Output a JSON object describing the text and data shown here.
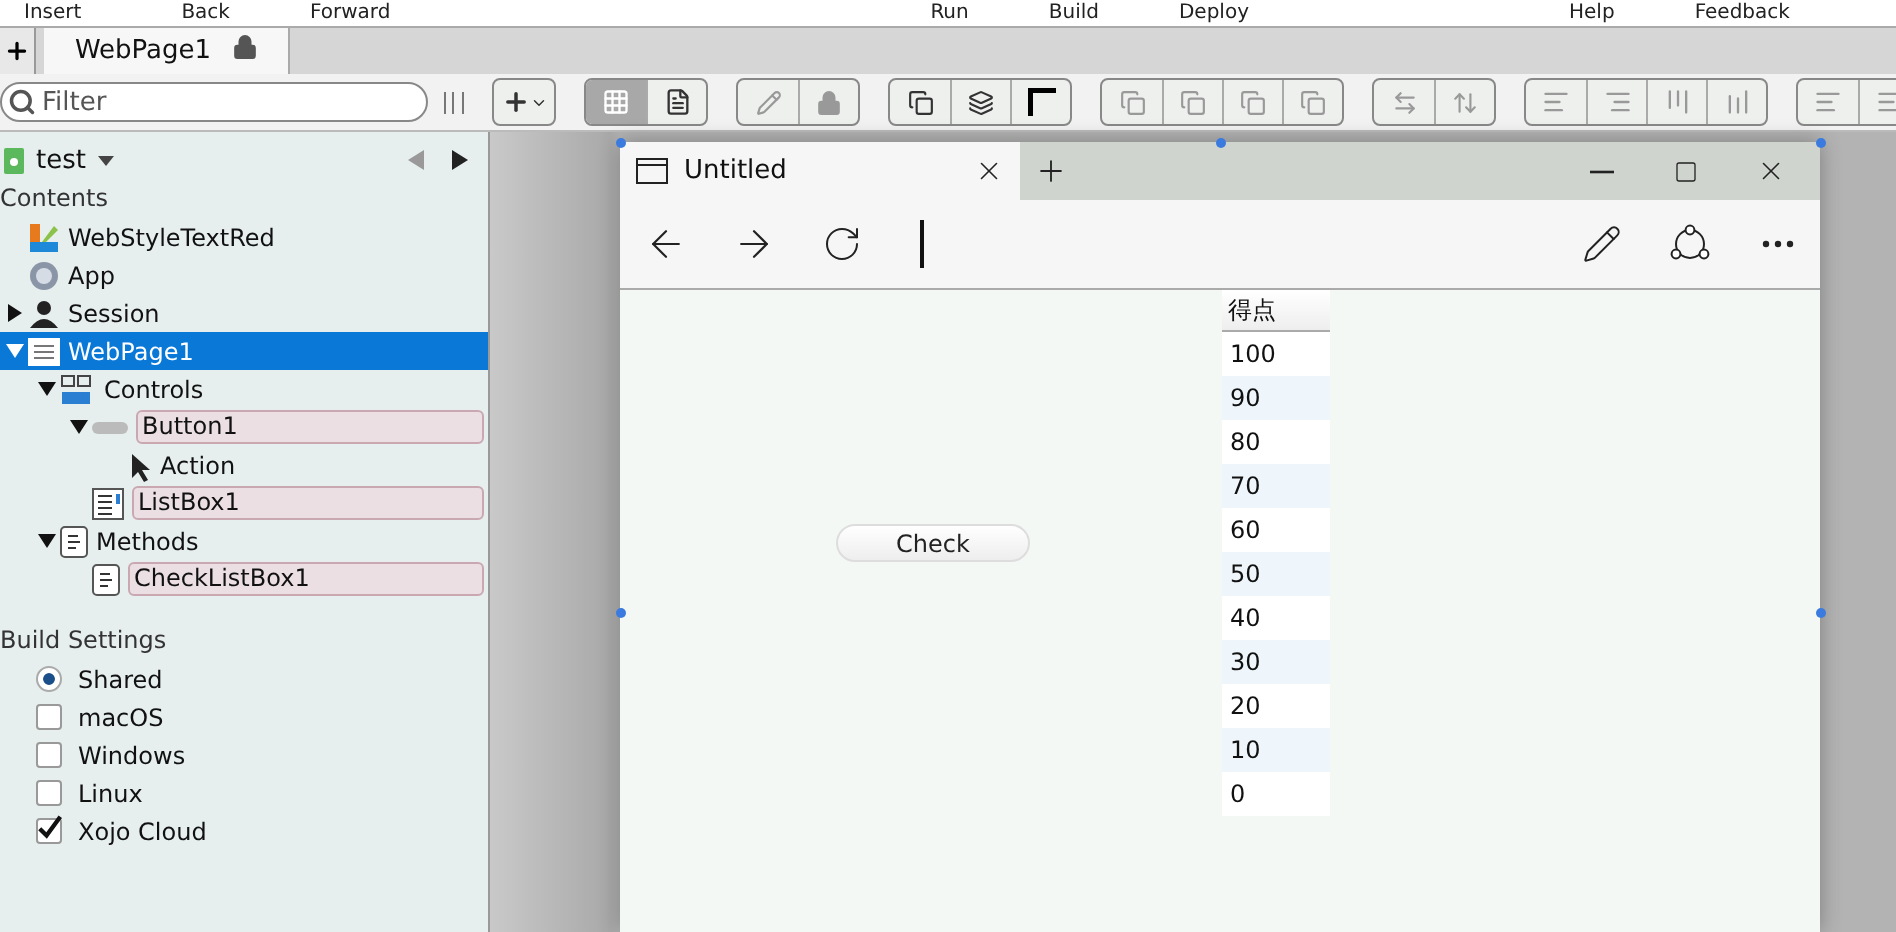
{
  "menu": [
    "Insert",
    "Back",
    "Forward",
    "Run",
    "Build",
    "Deploy",
    "Help",
    "Feedback"
  ],
  "tabs": [
    {
      "label": "WebPage1",
      "selected": true,
      "locked": true
    }
  ],
  "filter": {
    "placeholder": "Filter"
  },
  "project": {
    "name": "test"
  },
  "contents": {
    "title": "Contents",
    "items": [
      {
        "label": "WebStyleTextRed",
        "highlighted": false,
        "selected": false
      },
      {
        "label": "App",
        "highlighted": false,
        "selected": false
      },
      {
        "label": "Session",
        "expanded": false,
        "highlighted": false,
        "selected": false
      },
      {
        "label": "WebPage1",
        "expanded": true,
        "highlighted": false,
        "selected": true,
        "children": [
          {
            "label": "Controls",
            "expanded": true,
            "highlighted": false,
            "selected": false,
            "children": [
              {
                "label": "Button1",
                "expanded": true,
                "highlighted": true,
                "selected": false,
                "children": [
                  {
                    "label": "Action",
                    "highlighted": false,
                    "selected": false
                  }
                ]
              },
              {
                "label": "ListBox1",
                "highlighted": true,
                "selected": false
              }
            ]
          },
          {
            "label": "Methods",
            "expanded": true,
            "highlighted": false,
            "selected": false,
            "children": [
              {
                "label": "CheckListBox1",
                "highlighted": true,
                "selected": false
              }
            ]
          }
        ]
      }
    ]
  },
  "build_settings": {
    "title": "Build Settings",
    "items": [
      {
        "label": "Shared",
        "kind": "radio",
        "checked": true
      },
      {
        "label": "macOS",
        "kind": "checkbox",
        "checked": false
      },
      {
        "label": "Windows",
        "kind": "checkbox",
        "checked": false
      },
      {
        "label": "Linux",
        "kind": "checkbox",
        "checked": false
      },
      {
        "label": "Xojo Cloud",
        "kind": "checkbox",
        "checked": true
      }
    ]
  },
  "toolbar": {
    "view_modes": [
      {
        "kind": "grid",
        "selected": true
      },
      {
        "kind": "code",
        "selected": false
      }
    ]
  },
  "browser": {
    "tab_title": "Untitled",
    "button": {
      "label": "Check"
    },
    "listbox": {
      "header": "得点",
      "rows": [
        "100",
        "90",
        "80",
        "70",
        "60",
        "50",
        "40",
        "30",
        "20",
        "10",
        "0"
      ]
    }
  }
}
